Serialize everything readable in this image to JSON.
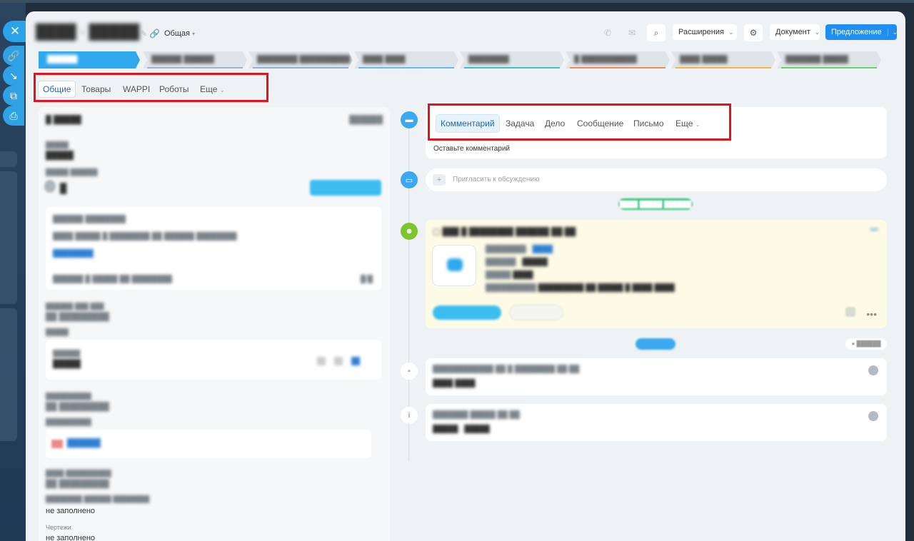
{
  "left_rail": {
    "close_icon": "close-icon",
    "buttons": [
      "link-icon",
      "download-icon",
      "open-external-icon",
      "print-icon"
    ]
  },
  "header": {
    "category": "Общая",
    "extensions_label": "Расширения",
    "document_label": "Документ",
    "offer_label": "Предложение"
  },
  "stage_colors": [
    "#2fa8ee",
    "#9fb3c8",
    "#8fb0d8",
    "#6fb7e8",
    "#3fc2c0",
    "#f08c5a",
    "#f0b840",
    "#6ccf6e",
    "#b3d47a"
  ],
  "left_tabs": [
    "Общие",
    "Товары",
    "WAPPI",
    "Роботы",
    "Еще"
  ],
  "left_fields": {
    "not_filled": "не заполнено",
    "drawings_label": "Чертежи",
    "drawings_value": "не заполнено"
  },
  "composer": {
    "tabs": [
      "Комментарий",
      "Задача",
      "Дело",
      "Сообщение",
      "Письмо",
      "Еще"
    ],
    "hint": "Оставьте комментарий"
  },
  "invite_placeholder": "Пригласить к обсуждению",
  "colors": {
    "accent": "#1f8ef0",
    "highlight_box": "#e0141e",
    "timeline_green": "#7dc52e"
  }
}
